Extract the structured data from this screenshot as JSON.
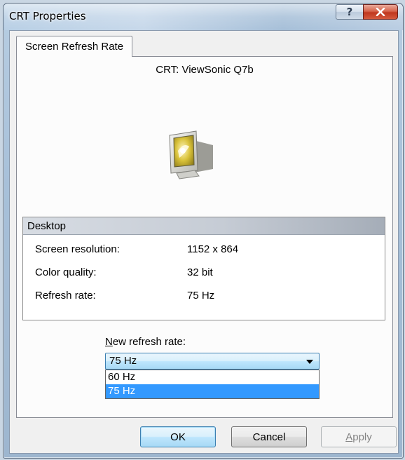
{
  "window": {
    "title": "CRT Properties",
    "help_label": "?",
    "close_label": "x"
  },
  "tabs": [
    {
      "label": "Screen Refresh Rate",
      "active": true
    }
  ],
  "monitor": {
    "name": "CRT: ViewSonic Q7b",
    "icon": "crt-monitor-icon"
  },
  "desktop_group": {
    "header": "Desktop",
    "rows": [
      {
        "label": "Screen resolution:",
        "value": "1152 x 864"
      },
      {
        "label": "Color quality:",
        "value": "32 bit"
      },
      {
        "label": "Refresh rate:",
        "value": "75 Hz"
      }
    ]
  },
  "new_refresh_rate": {
    "label_mnemonic": "N",
    "label_rest": "ew refresh rate:",
    "selected": "75 Hz",
    "options": [
      "60 Hz",
      "75 Hz"
    ],
    "highlighted_option": "75 Hz"
  },
  "buttons": {
    "ok": "OK",
    "cancel": "Cancel",
    "apply_mnemonic": "A",
    "apply_rest": "pply"
  },
  "colors": {
    "selection": "#3399ff",
    "close_button": "#c0371f",
    "title_gradient": "#b8cfe5"
  }
}
